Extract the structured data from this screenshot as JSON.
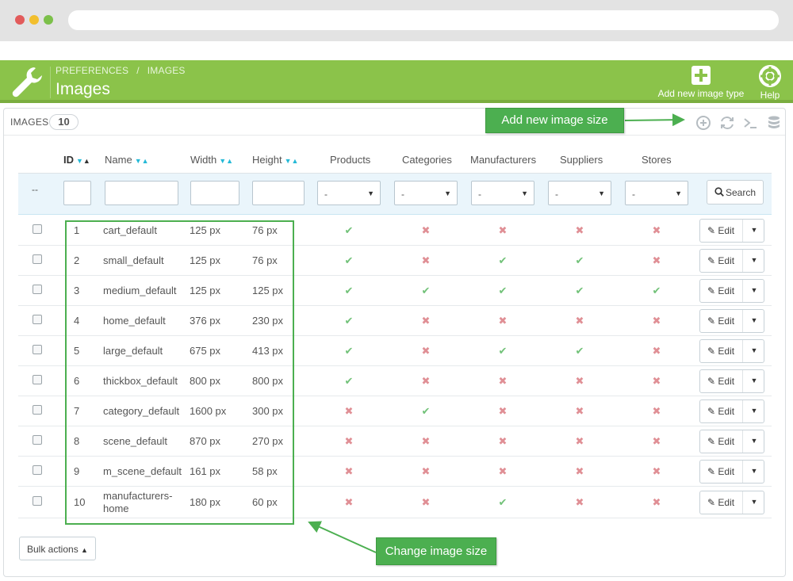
{
  "browser": {
    "url": ""
  },
  "header": {
    "breadcrumb": [
      "PREFERENCES",
      "/",
      "IMAGES"
    ],
    "title": "Images",
    "add_button_label": "Add new image type",
    "help_button_label": "Help",
    "accent_color": "#8bc34a"
  },
  "panel": {
    "title": "IMAGES",
    "count": "10",
    "tools": [
      "add-icon",
      "refresh-icon",
      "sql-query-icon",
      "database-icon"
    ]
  },
  "table": {
    "columns": {
      "id": "ID",
      "name": "Name",
      "width": "Width",
      "height": "Height",
      "products": "Products",
      "categories": "Categories",
      "manufacturers": "Manufacturers",
      "suppliers": "Suppliers",
      "stores": "Stores"
    },
    "filter": {
      "dash": "--",
      "select_value": "-",
      "search_label": "Search"
    },
    "edit_label": "Edit",
    "rows": [
      {
        "id": "1",
        "name": "cart_default",
        "width": "125 px",
        "height": "76 px",
        "flags": [
          true,
          false,
          false,
          false,
          false
        ]
      },
      {
        "id": "2",
        "name": "small_default",
        "width": "125 px",
        "height": "76 px",
        "flags": [
          true,
          false,
          true,
          true,
          false
        ]
      },
      {
        "id": "3",
        "name": "medium_default",
        "width": "125 px",
        "height": "125 px",
        "flags": [
          true,
          true,
          true,
          true,
          true
        ]
      },
      {
        "id": "4",
        "name": "home_default",
        "width": "376 px",
        "height": "230 px",
        "flags": [
          true,
          false,
          false,
          false,
          false
        ]
      },
      {
        "id": "5",
        "name": "large_default",
        "width": "675 px",
        "height": "413 px",
        "flags": [
          true,
          false,
          true,
          true,
          false
        ]
      },
      {
        "id": "6",
        "name": "thickbox_default",
        "width": "800 px",
        "height": "800 px",
        "flags": [
          true,
          false,
          false,
          false,
          false
        ]
      },
      {
        "id": "7",
        "name": "category_default",
        "width": "1600 px",
        "height": "300 px",
        "flags": [
          false,
          true,
          false,
          false,
          false
        ]
      },
      {
        "id": "8",
        "name": "scene_default",
        "width": "870 px",
        "height": "270 px",
        "flags": [
          false,
          false,
          false,
          false,
          false
        ]
      },
      {
        "id": "9",
        "name": "m_scene_default",
        "width": "161 px",
        "height": "58 px",
        "flags": [
          false,
          false,
          false,
          false,
          false
        ]
      },
      {
        "id": "10",
        "name": "manufacturers-home",
        "width": "180 px",
        "height": "60 px",
        "flags": [
          false,
          false,
          true,
          false,
          false
        ]
      }
    ],
    "bulk_actions_label": "Bulk actions"
  },
  "annotations": {
    "add_size": "Add new image size",
    "change_size": "Change image size",
    "color": "#4caf50"
  }
}
